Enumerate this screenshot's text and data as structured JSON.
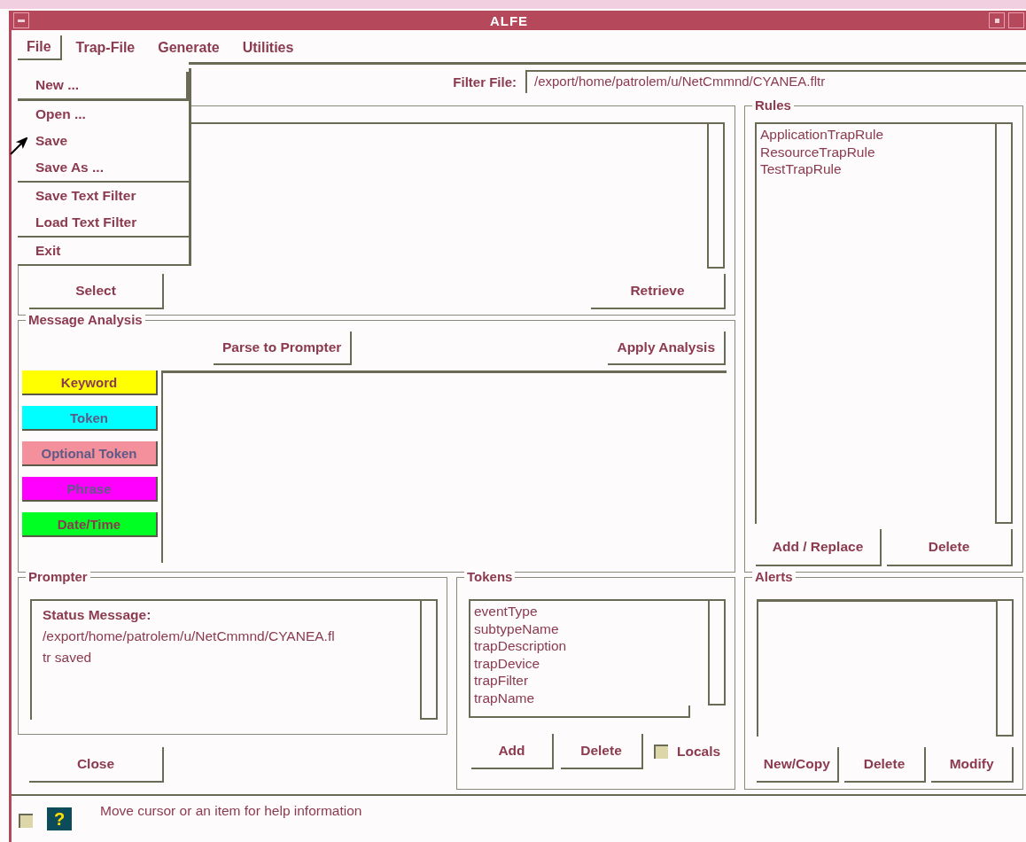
{
  "window": {
    "title": "ALFE"
  },
  "menu_bar": [
    {
      "label": "File",
      "selected": true
    },
    {
      "label": "Trap-File",
      "selected": false
    },
    {
      "label": "Generate",
      "selected": false
    },
    {
      "label": "Utilities",
      "selected": false
    }
  ],
  "file_menu": {
    "groups": [
      [
        {
          "label": "New ...",
          "selected": true
        },
        {
          "label": "Open ...",
          "selected": false
        },
        {
          "label": "Save",
          "selected": false
        },
        {
          "label": "Save As ...",
          "selected": false
        }
      ],
      [
        {
          "label": "Save Text Filter",
          "selected": false
        },
        {
          "label": "Load Text Filter",
          "selected": false
        }
      ],
      [
        {
          "label": "Exit",
          "selected": false
        }
      ]
    ]
  },
  "filter_file": {
    "label": "Filter File:",
    "value": "/export/home/patrolem/u/NetCmmnd/CYANEA.fltr"
  },
  "trap_panel": {
    "buttons": [
      "Select",
      "Retrieve"
    ]
  },
  "message_analysis": {
    "title": "Message Analysis",
    "buttons": [
      "Parse to Prompter",
      "Apply Analysis"
    ],
    "markers": [
      {
        "label": "Keyword",
        "color": "#ffff00",
        "disabled": false
      },
      {
        "label": "Token",
        "color": "#00ffff",
        "disabled": true
      },
      {
        "label": "Optional Token",
        "color": "#f4909c",
        "disabled": true
      },
      {
        "label": "Phrase",
        "color": "#ff00ff",
        "disabled": true
      },
      {
        "label": "Date/Time",
        "color": "#00ff22",
        "disabled": false
      }
    ]
  },
  "rules": {
    "title": "Rules",
    "items": [
      "ApplicationTrapRule",
      "ResourceTrapRule",
      "TestTrapRule"
    ],
    "buttons": [
      "Add / Replace",
      "Delete"
    ]
  },
  "prompter": {
    "title": "Prompter",
    "heading": "Status Message:",
    "lines": [
      "/export/home/patrolem/u/NetCmmnd/CYANEA.fl",
      "tr saved"
    ]
  },
  "close_button": "Close",
  "tokens": {
    "title": "Tokens",
    "items": [
      "eventType",
      "subtypeName",
      "trapDescription",
      "trapDevice",
      "trapFilter",
      "trapName"
    ],
    "buttons": [
      "Add",
      "Delete"
    ],
    "locals": {
      "label": "Locals",
      "checked": false
    }
  },
  "alerts": {
    "title": "Alerts",
    "buttons": [
      "New/Copy",
      "Delete",
      "Modify"
    ]
  },
  "status_bar": {
    "help_glyph": "?",
    "message": "Move cursor or an item for help information"
  }
}
